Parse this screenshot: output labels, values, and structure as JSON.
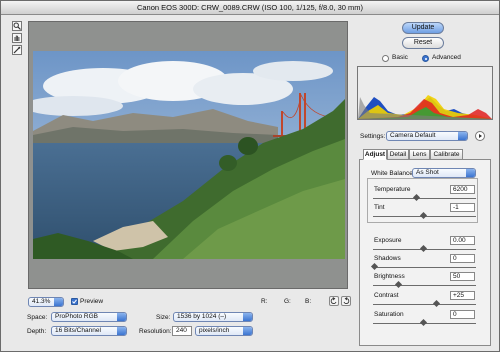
{
  "window": {
    "title": "Canon EOS 300D:  CRW_0089.CRW  (ISO 100, 1/125, f/8.0, 30 mm)"
  },
  "tools": [
    {
      "name": "zoom-tool",
      "glyph": "🔍"
    },
    {
      "name": "hand-tool",
      "glyph": "✋"
    },
    {
      "name": "white-balance-tool",
      "glyph": "✎"
    }
  ],
  "preview_bar": {
    "zoom": "41.3%",
    "preview_label": "Preview",
    "preview_checked": true,
    "r_label": "R:",
    "g_label": "G:",
    "b_label": "B:"
  },
  "workflow": {
    "space_label": "Space:",
    "space_value": "ProPhoto RGB",
    "size_label": "Size:",
    "size_value": "1536 by 1024  (–)",
    "depth_label": "Depth:",
    "depth_value": "16 Bits/Channel",
    "resolution_label": "Resolution:",
    "resolution_value": "240",
    "resolution_unit": "pixels/inch"
  },
  "buttons": {
    "update": "Update",
    "reset": "Reset"
  },
  "mode": {
    "basic": "Basic",
    "advanced": "Advanced",
    "selected": "advanced"
  },
  "settings": {
    "label": "Settings:",
    "value": "Camera Default"
  },
  "tabs": [
    {
      "label": "Adjust",
      "active": true
    },
    {
      "label": "Detail",
      "active": false
    },
    {
      "label": "Lens",
      "active": false
    },
    {
      "label": "Calibrate",
      "active": false
    }
  ],
  "adjust": {
    "white_balance_label": "White Balance:",
    "white_balance_value": "As Shot",
    "temperature_label": "Temperature",
    "temperature_value": "6200",
    "tint_label": "Tint",
    "tint_value": "-1",
    "exposure_label": "Exposure",
    "exposure_value": "0.00",
    "shadows_label": "Shadows",
    "shadows_value": "0",
    "brightness_label": "Brightness",
    "brightness_value": "50",
    "contrast_label": "Contrast",
    "contrast_value": "+25",
    "saturation_label": "Saturation",
    "saturation_value": "0"
  },
  "colors": {
    "accent": "#3b74d0",
    "update_button": "#8fb7f0",
    "preview_background": "#8f918f"
  }
}
